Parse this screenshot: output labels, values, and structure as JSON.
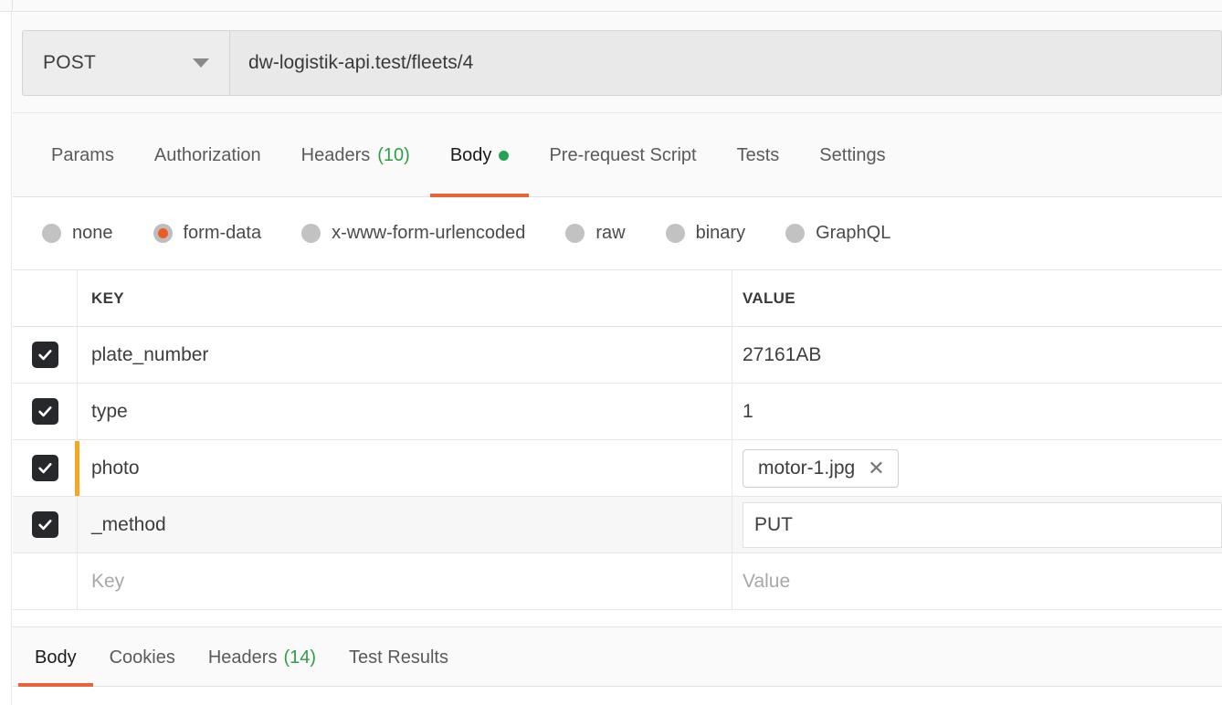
{
  "request": {
    "method": "POST",
    "method_caret_icon": "chevron-down-icon",
    "url": "dw-logistik-api.test/fleets/4"
  },
  "request_tabs": [
    {
      "label": "Params",
      "active": false
    },
    {
      "label": "Authorization",
      "active": false
    },
    {
      "label": "Headers",
      "count": "(10)",
      "active": false
    },
    {
      "label": "Body",
      "active": true,
      "has_dot": true
    },
    {
      "label": "Pre-request Script",
      "active": false
    },
    {
      "label": "Tests",
      "active": false
    },
    {
      "label": "Settings",
      "active": false
    }
  ],
  "body_types": [
    {
      "label": "none",
      "selected": false
    },
    {
      "label": "form-data",
      "selected": true
    },
    {
      "label": "x-www-form-urlencoded",
      "selected": false
    },
    {
      "label": "raw",
      "selected": false
    },
    {
      "label": "binary",
      "selected": false
    },
    {
      "label": "GraphQL",
      "selected": false
    }
  ],
  "table": {
    "headers": {
      "key": "KEY",
      "value": "VALUE"
    },
    "rows": [
      {
        "checked": true,
        "key": "plate_number",
        "value": "27161AB",
        "value_kind": "text"
      },
      {
        "checked": true,
        "key": "type",
        "value": "1",
        "value_kind": "text"
      },
      {
        "checked": true,
        "key": "photo",
        "value": "motor-1.jpg",
        "value_kind": "file",
        "active": true,
        "remove_icon": "close-icon"
      },
      {
        "checked": true,
        "key": "_method",
        "value": "PUT",
        "value_kind": "input",
        "shaded": true
      }
    ],
    "new_row": {
      "key_placeholder": "Key",
      "value_placeholder": "Value"
    }
  },
  "response_tabs": [
    {
      "label": "Body",
      "active": true
    },
    {
      "label": "Cookies",
      "active": false
    },
    {
      "label": "Headers",
      "count": "(14)",
      "active": false
    },
    {
      "label": "Test Results",
      "active": false
    }
  ],
  "colors": {
    "accent_orange": "#e8623a",
    "radio_selected": "#ef5b25",
    "row_indicator": "#f5a623",
    "count_green": "#2f9e44",
    "dot_green": "#23a455"
  }
}
